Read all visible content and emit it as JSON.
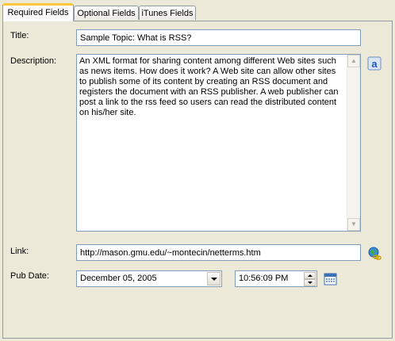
{
  "tabs": [
    {
      "label": "Required Fields",
      "active": true
    },
    {
      "label": "Optional Fields",
      "active": false
    },
    {
      "label": "iTunes Fields",
      "active": false
    }
  ],
  "form": {
    "title_label": "Title:",
    "title_value": "Sample Topic: What is RSS?",
    "description_label": "Description:",
    "description_value": "An XML format for sharing content among different Web sites such as news items. How does it work? A Web site can allow other sites to publish some of its content by creating an RSS document and registers the document with an RSS publisher. A web publisher can post a link to the rss feed so users can read the distributed content on his/her site.",
    "link_label": "Link:",
    "link_value": "http://mason.gmu.edu/~montecin/netterms.htm",
    "pubdate_label": "Pub Date:",
    "pubdate_value": "December 05, 2005",
    "time_value": "10:56:09 PM"
  },
  "icons": {
    "text_format": "text-format-icon",
    "web_link": "web-link-icon",
    "calendar": "calendar-icon"
  },
  "colors": {
    "window_bg": "#ece9d8",
    "field_border": "#7f9db9",
    "active_tab_accent": "#ffc83c"
  }
}
